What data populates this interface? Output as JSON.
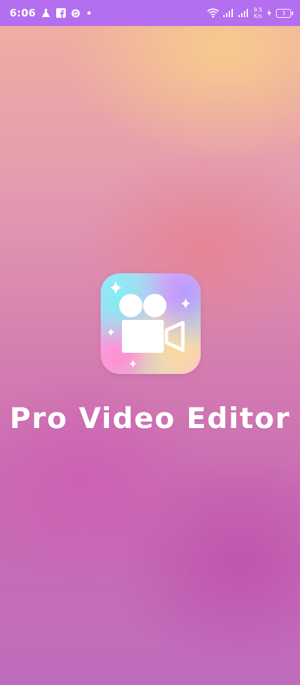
{
  "status_bar": {
    "time": "6:06",
    "icons": [
      "flask-icon",
      "facebook-icon",
      "sync-icon",
      "dot-icon"
    ],
    "netspeed_value": "9.5",
    "netspeed_unit": "K/s",
    "battery_level": "3",
    "background_color": "#b46ef0"
  },
  "splash": {
    "app_title": "Pro Video Editor",
    "app_icon": "video-camera-icon"
  }
}
